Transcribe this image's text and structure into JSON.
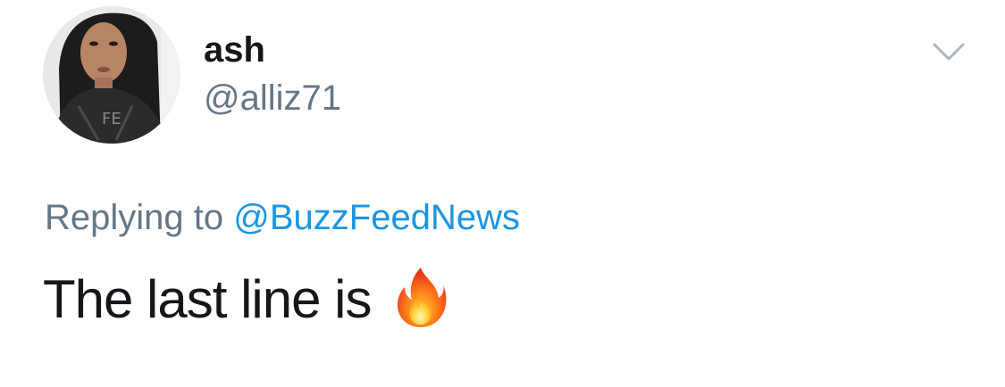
{
  "tweet": {
    "author": {
      "display_name": "ash",
      "handle": "@alliz71",
      "avatar_icon": "user-avatar-photo"
    },
    "menu_icon": "chevron-down-icon",
    "replying_prefix": "Replying to",
    "replying_to": "@BuzzFeedNews",
    "text": "The last line is",
    "emoji_icon": "fire-emoji-icon"
  },
  "colors": {
    "primary_text": "#14171a",
    "secondary_text": "#657786",
    "link": "#1b95e0",
    "background": "#ffffff"
  }
}
